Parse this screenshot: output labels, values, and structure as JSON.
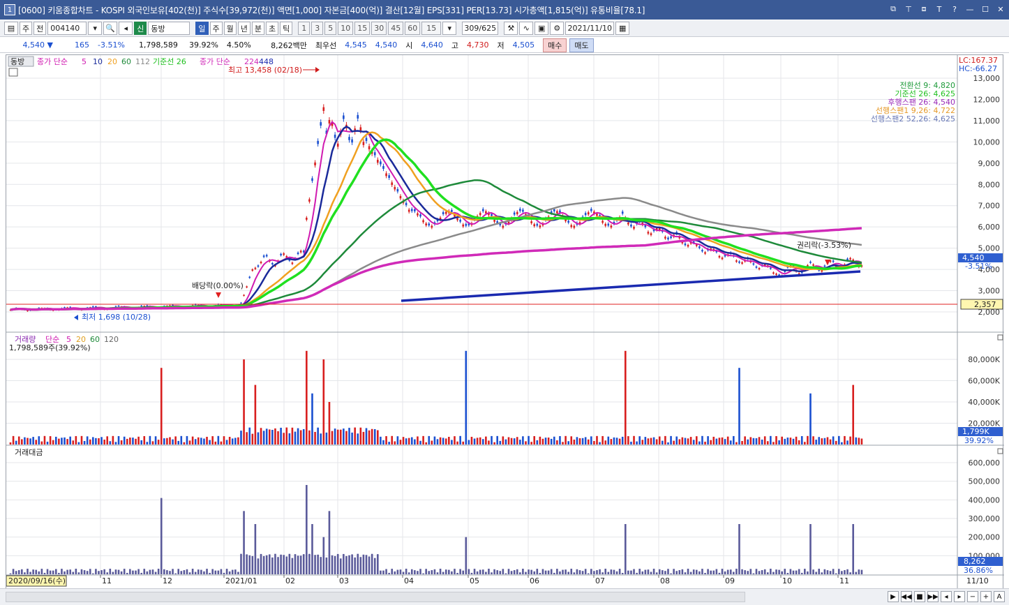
{
  "window": {
    "num": "1",
    "title": "[0600] 키움종합차트 - KOSPI 외국인보유[402(천)] 주식수[39,972(천)] 액면[1,000] 자본금[400(억)] 결산[12월] EPS[331] PER[13.73] 시가총액[1,815(억)] 유통비율[78.1]"
  },
  "toolbar": {
    "mode1": "주",
    "mode2": "전",
    "code": "004140",
    "market_badge": "신",
    "name": "동방",
    "periods": [
      "일",
      "주",
      "월",
      "년",
      "분",
      "초",
      "틱"
    ],
    "active_period": "일",
    "intervals": [
      "1",
      "3",
      "5",
      "10",
      "15",
      "30",
      "45",
      "60"
    ],
    "interval_value": "15",
    "count": "309",
    "total": "/625",
    "date": "2021/11/10"
  },
  "quote": {
    "price": "4,540",
    "change": "165",
    "change_pct": "-3.51%",
    "volume": "1,798,589",
    "vol_ratio": "39.92%",
    "turnover": "4.50%",
    "amount": "8,262백만",
    "best_label": "최우선",
    "best_ask": "4,545",
    "best_bid": "4,540",
    "open_label": "시",
    "open": "4,640",
    "high_label": "고",
    "high": "4,730",
    "low_label": "저",
    "low": "4,505",
    "buy": "매수",
    "sell": "매도"
  },
  "price_pane": {
    "stock_tag": "동방",
    "ma_label": "종가 단순",
    "ma_periods": [
      "5",
      "10",
      "20",
      "60",
      "112"
    ],
    "base_line": "기준선 26",
    "ma2_label": "종가 단순",
    "ma2_periods": [
      "224",
      "448"
    ],
    "lc": "LC:167.37",
    "hc": "HC:-66.27",
    "high_annot": "최고 13,458 (02/18)",
    "low_annot": "최저 1,698 (10/28)",
    "dividend_annot": "배당락(0.00%)",
    "rights_annot": "권리락(-3.53%)",
    "current_price": "4,540",
    "current_pct": "-3.51%",
    "ref_price": "2,357",
    "ichimoku": [
      {
        "text": "전환선 9: 4,820",
        "color": "#1e9a3a"
      },
      {
        "text": "기준선 26: 4,625",
        "color": "#20c020"
      },
      {
        "text": "후행스팬 26: 4,540",
        "color": "#9a2ab8"
      },
      {
        "text": "선행스팬1 9,26: 4,722",
        "color": "#e69a2a"
      },
      {
        "text": "선행스팬2 52,26: 4,625",
        "color": "#6a7ab8"
      }
    ],
    "y_ticks": [
      "13,000",
      "12,000",
      "11,000",
      "10,000",
      "9,000",
      "8,000",
      "7,000",
      "6,000",
      "5,000",
      "4,000",
      "3,000",
      "2,000"
    ]
  },
  "volume_pane": {
    "label": "거래량",
    "ma_label": "단순",
    "ma_periods": [
      "5",
      "20",
      "60",
      "120"
    ],
    "current": "1,798,589주(39.92%)",
    "y_ticks": [
      "80,000K",
      "60,000K",
      "40,000K",
      "20,000K"
    ],
    "value_box": "1,799K",
    "pct_box": "39.92%"
  },
  "amount_pane": {
    "label": "거래대금",
    "y_ticks": [
      "600,000",
      "500,000",
      "400,000",
      "300,000",
      "200,000",
      "100,000"
    ],
    "value_box": "8,262",
    "pct_box": "36.86%"
  },
  "x_axis": {
    "start_date": "2020/09/16(수)",
    "labels": [
      "11",
      "12",
      "2021/01",
      "02",
      "03",
      "04",
      "05",
      "06",
      "07",
      "08",
      "09",
      "10",
      "11"
    ],
    "end_label": "11/10"
  },
  "colors": {
    "up": "#d81e1e",
    "down": "#1a4fd0",
    "ma5": "#d01ab0",
    "ma10": "#1a2a9a",
    "ma20": "#f0a020",
    "ma60": "#1e8a3a",
    "ma112": "#8a8a8a",
    "base": "#20e020",
    "ma224": "#d02ab8",
    "ma448": "#1a2ab0"
  }
}
